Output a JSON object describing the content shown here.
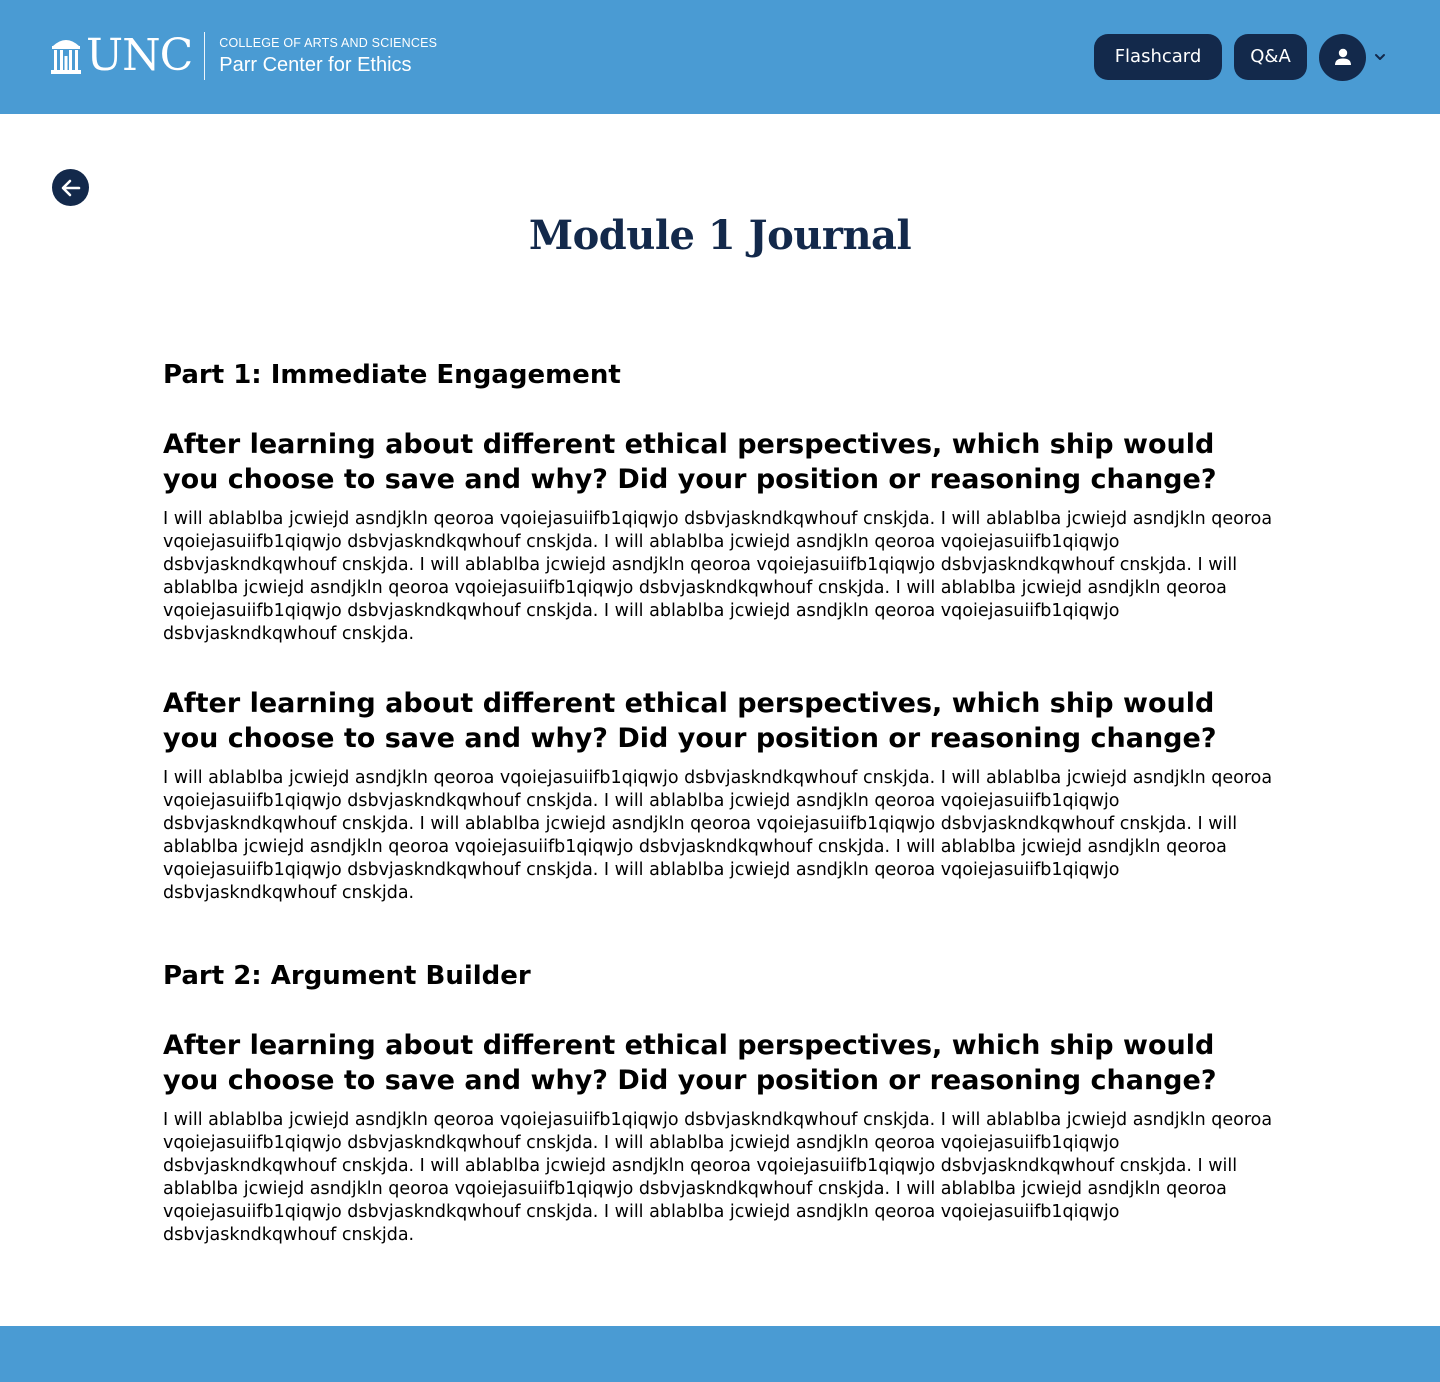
{
  "colors": {
    "header_bg": "#4a9bd3",
    "navy": "#13294b",
    "white": "#ffffff"
  },
  "header": {
    "logo": {
      "wordmark": "UNC",
      "college": "COLLEGE OF ARTS AND SCIENCES",
      "center": "Parr Center for Ethics",
      "icon": "old-well-icon"
    },
    "nav": {
      "flashcard_label": "Flashcard",
      "qa_label": "Q&A",
      "user_icon": "user-icon",
      "menu_icon": "chevron-down-icon"
    }
  },
  "back_icon": "arrow-left-icon",
  "page": {
    "title": "Module 1 Journal",
    "parts": [
      {
        "heading": "Part 1: Immediate Engagement",
        "entries": [
          {
            "question": "After learning about different ethical perspectives, which ship would you choose to save and why? Did your position or reasoning change?",
            "answer": "I will ablablba jcwiejd  asndjkln qeoroa  vqoiejasuiifb1qiqwjo dsbvjaskndkqwhouf cnskjda. I will ablablba jcwiejd  asndjkln qeoroa  vqoiejasuiifb1qiqwjo dsbvjaskndkqwhouf cnskjda. I will ablablba jcwiejd  asndjkln qeoroa  vqoiejasuiifb1qiqwjo dsbvjaskndkqwhouf cnskjda. I will ablablba jcwiejd  asndjkln qeoroa  vqoiejasuiifb1qiqwjo dsbvjaskndkqwhouf cnskjda. I will ablablba jcwiejd  asndjkln qeoroa  vqoiejasuiifb1qiqwjo dsbvjaskndkqwhouf cnskjda. I will ablablba jcwiejd  asndjkln qeoroa  vqoiejasuiifb1qiqwjo dsbvjaskndkqwhouf cnskjda. I will ablablba jcwiejd  asndjkln qeoroa  vqoiejasuiifb1qiqwjo dsbvjaskndkqwhouf cnskjda."
          },
          {
            "question": "After learning about different ethical perspectives, which ship would you choose to save and why? Did your position or reasoning change?",
            "answer": "I will ablablba jcwiejd  asndjkln qeoroa  vqoiejasuiifb1qiqwjo dsbvjaskndkqwhouf cnskjda. I will ablablba jcwiejd  asndjkln qeoroa  vqoiejasuiifb1qiqwjo dsbvjaskndkqwhouf cnskjda. I will ablablba jcwiejd  asndjkln qeoroa  vqoiejasuiifb1qiqwjo dsbvjaskndkqwhouf cnskjda. I will ablablba jcwiejd  asndjkln qeoroa  vqoiejasuiifb1qiqwjo dsbvjaskndkqwhouf cnskjda. I will ablablba jcwiejd  asndjkln qeoroa  vqoiejasuiifb1qiqwjo dsbvjaskndkqwhouf cnskjda. I will ablablba jcwiejd  asndjkln qeoroa  vqoiejasuiifb1qiqwjo dsbvjaskndkqwhouf cnskjda. I will ablablba jcwiejd  asndjkln qeoroa  vqoiejasuiifb1qiqwjo dsbvjaskndkqwhouf cnskjda."
          }
        ]
      },
      {
        "heading": "Part 2: Argument Builder",
        "entries": [
          {
            "question": "After learning about different ethical perspectives, which ship would you choose to save and why? Did your position or reasoning change?",
            "answer": "I will ablablba jcwiejd  asndjkln qeoroa  vqoiejasuiifb1qiqwjo dsbvjaskndkqwhouf cnskjda. I will ablablba jcwiejd  asndjkln qeoroa  vqoiejasuiifb1qiqwjo dsbvjaskndkqwhouf cnskjda. I will ablablba jcwiejd  asndjkln qeoroa  vqoiejasuiifb1qiqwjo dsbvjaskndkqwhouf cnskjda. I will ablablba jcwiejd  asndjkln qeoroa  vqoiejasuiifb1qiqwjo dsbvjaskndkqwhouf cnskjda. I will ablablba jcwiejd  asndjkln qeoroa  vqoiejasuiifb1qiqwjo dsbvjaskndkqwhouf cnskjda. I will ablablba jcwiejd  asndjkln qeoroa  vqoiejasuiifb1qiqwjo dsbvjaskndkqwhouf cnskjda. I will ablablba jcwiejd  asndjkln qeoroa  vqoiejasuiifb1qiqwjo dsbvjaskndkqwhouf cnskjda."
          }
        ]
      }
    ]
  }
}
